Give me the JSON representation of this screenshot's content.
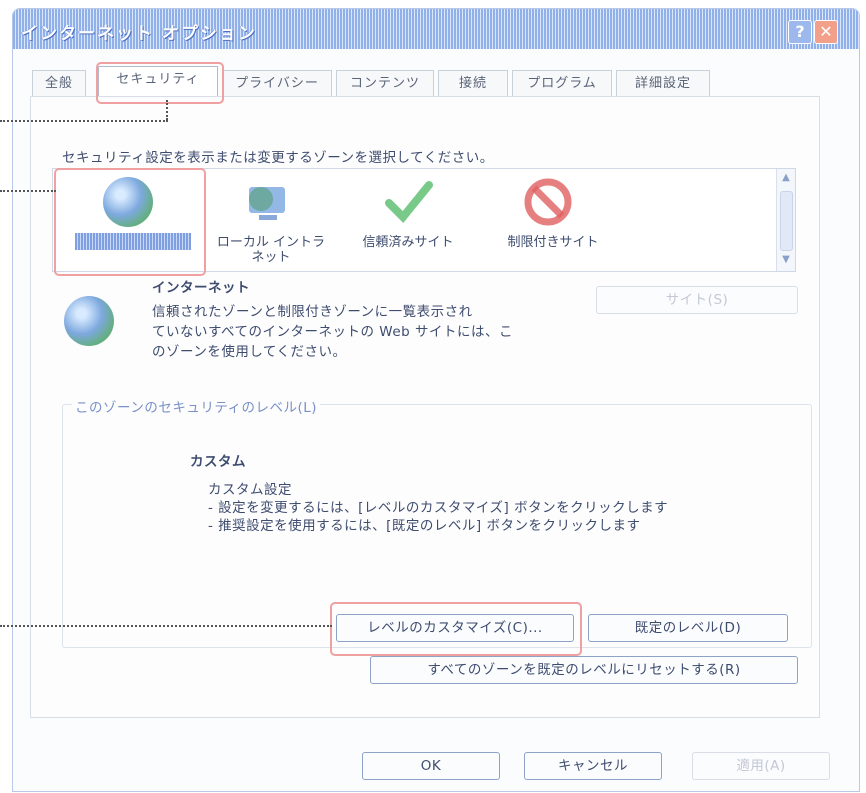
{
  "window": {
    "title": "インターネット オプション",
    "help_label": "?",
    "close_label": "✕"
  },
  "tabs": [
    {
      "label": "全般"
    },
    {
      "label": "セキュリティ"
    },
    {
      "label": "プライバシー"
    },
    {
      "label": "コンテンツ"
    },
    {
      "label": "接続"
    },
    {
      "label": "プログラム"
    },
    {
      "label": "詳細設定"
    }
  ],
  "security": {
    "instruction": "セキュリティ設定を表示または変更するゾーンを選択してください。",
    "zones": [
      {
        "label": "インターネット",
        "icon": "globe-icon"
      },
      {
        "label": "ローカル イントラネット",
        "icon": "local-intranet-icon"
      },
      {
        "label": "信頼済みサイト",
        "icon": "check-icon"
      },
      {
        "label": "制限付きサイト",
        "icon": "restricted-icon"
      }
    ],
    "selected_zone": {
      "name": "インターネット",
      "description": "信頼されたゾーンと制限付きゾーンに一覧表示されていないすべてのインターネットの Web サイトには、このゾーンを使用してください。",
      "desc_line1": "信頼されたゾーンと制限付きゾーンに一覧表示され",
      "desc_line2": "ていないすべてのインターネットの Web サイトには、こ",
      "desc_line3": "のゾーンを使用してください。"
    },
    "sites_button": "サイト(S)"
  },
  "level": {
    "group_title": "このゾーンのセキュリティのレベル(L)",
    "heading": "カスタム",
    "subheading": "カスタム設定",
    "bullet1": "- 設定を変更するには、[レベルのカスタマイズ] ボタンをクリックします",
    "bullet2": "- 推奨設定を使用するには、[既定のレベル] ボタンをクリックします",
    "customize_button": "レベルのカスタマイズ(C)...",
    "default_button": "既定のレベル(D)",
    "reset_all_button": "すべてのゾーンを既定のレベルにリセットする(R)"
  },
  "footer": {
    "ok": "OK",
    "cancel": "キャンセル",
    "apply": "適用(A)"
  },
  "colors": {
    "callout": "#f0a0a0",
    "titlebar": "#8fb0e8"
  }
}
